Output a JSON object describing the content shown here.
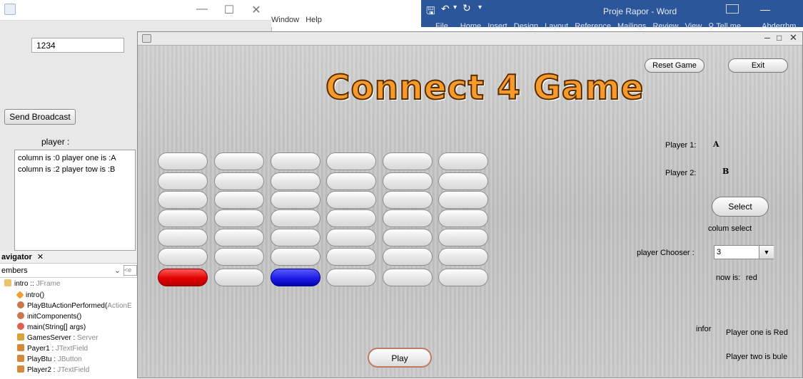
{
  "left_window": {
    "port_value": "1234",
    "send_broadcast": "Send Broadcast",
    "player_label": "player :",
    "log_lines": [
      "column is :0 player one is :A",
      "column is :2 player tow is :B"
    ]
  },
  "navigator": {
    "tab": "avigator",
    "combo": "embers",
    "combo_field": "<e",
    "tree": [
      {
        "name": "intro :: ",
        "type": "JFrame"
      },
      {
        "name": "intro()",
        "type": ""
      },
      {
        "name": "PlayBtuActionPerformed(",
        "type": "ActionE"
      },
      {
        "name": "initComponents()",
        "type": ""
      },
      {
        "name": "main(String[] args)",
        "type": ""
      },
      {
        "name": "GamesServer : ",
        "type": "Server"
      },
      {
        "name": "Payer1 : ",
        "type": "JTextField"
      },
      {
        "name": "PlayBtu : ",
        "type": "JButton"
      },
      {
        "name": "Player2 : ",
        "type": "JTextField"
      }
    ]
  },
  "eclipse": {
    "menu_window": "Window",
    "menu_help": "Help"
  },
  "word": {
    "title": "Proje Rapor - Word",
    "tabs": [
      "File",
      "Home",
      "Insert",
      "Design",
      "Layout",
      "Reference",
      "Mailings",
      "Review",
      "View",
      "Tell me",
      "Abderrhm"
    ]
  },
  "game": {
    "title": "Connect 4 Game",
    "reset_button": "Reset Game",
    "exit_button": "Exit",
    "player1_label": "Player 1:",
    "player1_value": "A",
    "player2_label": "Player 2:",
    "player2_value": "B",
    "select_button": "Select",
    "colum_select": "colum select",
    "chooser_label": "player Chooser :",
    "chooser_value": "3",
    "now_is_label": "now is:",
    "now_is_value": "red",
    "infor_label": "infor",
    "info_line1": "Player one is Red",
    "info_line2": "Player two is bule",
    "play_button": "Play",
    "board": [
      [
        "empty",
        "empty",
        "empty",
        "empty",
        "empty",
        "empty"
      ],
      [
        "empty",
        "empty",
        "empty",
        "empty",
        "empty",
        "empty"
      ],
      [
        "empty",
        "empty",
        "empty",
        "empty",
        "empty",
        "empty"
      ],
      [
        "empty",
        "empty",
        "empty",
        "empty",
        "empty",
        "empty"
      ],
      [
        "empty",
        "empty",
        "empty",
        "empty",
        "empty",
        "empty"
      ],
      [
        "empty",
        "empty",
        "empty",
        "empty",
        "empty",
        "empty"
      ],
      [
        "red",
        "empty",
        "blue",
        "empty",
        "empty",
        "empty"
      ]
    ]
  }
}
